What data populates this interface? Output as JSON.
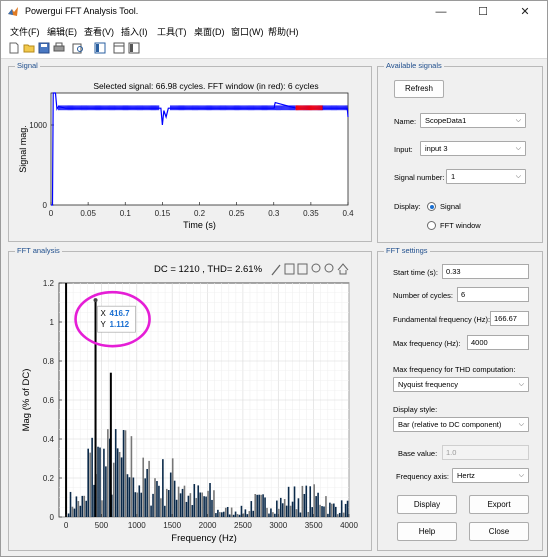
{
  "window": {
    "title": "Powergui FFT Analysis Tool.",
    "controls": {
      "minimize": "—",
      "maximize": "☐",
      "close": "✕"
    }
  },
  "menu": [
    "文件(F)",
    "编辑(E)",
    "查看(V)",
    "插入(I)",
    "工具(T)",
    "桌面(D)",
    "窗口(W)",
    "帮助(H)"
  ],
  "toolbar_icons": [
    "new-file-icon",
    "open-folder-icon",
    "save-icon",
    "print-icon",
    "print-preview-icon",
    "layout-icon",
    "dock-icon",
    "property-inspector-icon"
  ],
  "signal_panel": {
    "title": "Signal",
    "chart_title": "Selected signal: 66.98 cycles. FFT window (in red): 6 cycles"
  },
  "fft_panel": {
    "title": "FFT analysis",
    "chart_title": "DC = 1210 , THD= 2.61%",
    "datatip": {
      "x_label": "X",
      "x_value": "416.7",
      "y_label": "Y",
      "y_value": "1.112"
    }
  },
  "available_signals": {
    "title": "Available signals",
    "refresh": "Refresh",
    "name_label": "Name:",
    "name_value": "ScopeData1",
    "input_label": "Input:",
    "input_value": "input 3",
    "signal_number_label": "Signal number:",
    "signal_number_value": "1",
    "display_label": "Display:",
    "display_signal": "Signal",
    "display_fft": "FFT window"
  },
  "fft_settings": {
    "title": "FFT settings",
    "start_time_label": "Start time (s):",
    "start_time_value": "0.33",
    "cycles_label": "Number of cycles:",
    "cycles_value": "6",
    "fund_label": "Fundamental frequency (Hz):",
    "fund_value": "166.67",
    "maxf_label": "Max frequency (Hz):",
    "maxf_value": "4000",
    "thd_label": "Max frequency for THD computation:",
    "thd_value": "Nyquist frequency",
    "style_label": "Display style:",
    "style_value": "Bar (relative to DC component)",
    "base_label": "Base value:",
    "base_value": "1.0",
    "axis_label": "Frequency axis:",
    "axis_value": "Hertz",
    "display_btn": "Display",
    "export_btn": "Export",
    "help_btn": "Help",
    "close_btn": "Close"
  },
  "colors": {
    "signal_line": "#0000ff",
    "fft_window": "#ff0000",
    "bar_dark": "#0b2a4a",
    "bar_gray": "#777777",
    "annotation": "#e51ed6",
    "datatip_value": "#1a6fd1"
  },
  "chart_data": [
    {
      "type": "line",
      "xlabel": "Time (s)",
      "ylabel": "Signal mag.",
      "xlim": [
        0,
        0.4
      ],
      "ylim": [
        0,
        1400
      ],
      "xticks": [
        "0",
        "0.05",
        "0.1",
        "0.15",
        "0.2",
        "0.25",
        "0.3",
        "0.35",
        "0.4"
      ],
      "yticks": [
        "0",
        "1000"
      ],
      "series": [
        {
          "x": [
            0,
            0.002,
            0.003,
            0.006,
            0.008,
            0.01,
            0.02,
            0.05,
            0.1,
            0.148,
            0.15,
            0.152,
            0.155,
            0.158,
            0.2,
            0.25,
            0.3,
            0.302,
            0.33,
            0.36,
            0.399,
            0.4
          ],
          "y": [
            0,
            0,
            1400,
            1400,
            1200,
            1230,
            1210,
            1210,
            1210,
            1210,
            1000,
            1180,
            1100,
            1210,
            1210,
            1210,
            1210,
            1280,
            1210,
            1210,
            1210,
            1100
          ]
        }
      ],
      "fft_window": {
        "x": [
          0.33,
          0.366
        ]
      }
    },
    {
      "type": "bar",
      "xlabel": "Frequency (Hz)",
      "ylabel": "Mag (% of DC)",
      "xlim": [
        -100,
        4000
      ],
      "ylim": [
        0,
        1.2
      ],
      "xticks": [
        "0",
        "500",
        "1000",
        "1500",
        "2000",
        "2500",
        "3000",
        "3500",
        "4000"
      ],
      "yticks": [
        "0",
        "0.2",
        "0.4",
        "0.6",
        "0.8",
        "1",
        "1.2"
      ],
      "highlights": [
        {
          "x": 0,
          "y": 1.2
        },
        {
          "x": 416.7,
          "y": 1.112
        },
        {
          "x": 633,
          "y": 0.74
        }
      ]
    }
  ]
}
